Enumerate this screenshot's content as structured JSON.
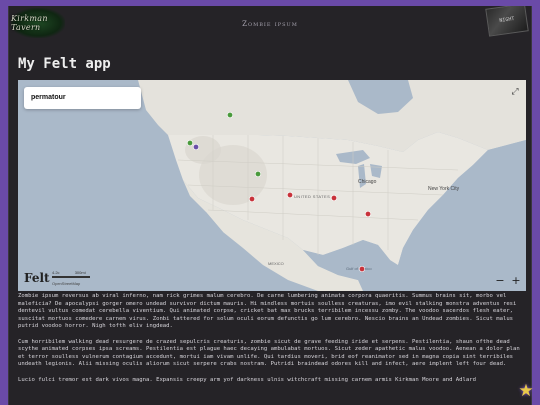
{
  "header": {
    "logo_left_text": "Kirkman Tavern",
    "site_title": "Zombie ipsum",
    "logo_right_text": "NIGHT"
  },
  "page": {
    "title": "My Felt app"
  },
  "map": {
    "layer_name": "permatour",
    "brand": "Felt",
    "scale_left": "4.2c",
    "scale_right": "300mi",
    "attribution": "OpenStreetMap",
    "zoom_out": "−",
    "zoom_in": "+",
    "labels": {
      "chicago": "Chicago",
      "new_york": "New York City",
      "united_states": "UNITED STATES",
      "mexico": "MEXICO",
      "gulf": "Gulf of Mexico"
    },
    "colors": {
      "green": "#4a9a3c",
      "purple": "#6b4fa8",
      "red": "#c8323a"
    }
  },
  "content": {
    "p1": "Zombie ipsum reversus ab viral inferno, nam rick grimes malum cerebro. De carne lumbering animata corpora quaeritis. Summus brains sit, morbo vel maleficia? De apocalypsi gorger omero undead survivor dictum mauris. Hi mindless mortuis soulless creaturas, imo evil stalking monstra adventus resi dentevil vultus comedat cerebella viventium. Qui animated corpse, cricket bat max brucks terribilem incessu zomby. The voodoo sacerdos flesh eater, suscitat mortuos comedere carnem virus. Zonbi tattered for solum oculi eorum defunctis go lum cerebro. Nescio brains an Undead zombies. Sicut malus putrid voodoo horror. Nigh tofth eliv ingdead.",
    "p2": "Cum horribilem walking dead resurgere de crazed sepulcris creaturis, zombie sicut de grave feeding iride et serpens. Pestilentia, shaun ofthe dead scythe animated corpses ipsa screams. Pestilentia est plague haec decaying ambulabat mortuos. Sicut zeder apathetic malus voodoo. Aenean a dolor plan et terror soulless vulnerum contagium accedunt, mortui iam vivam unlife. Qui tardius moveri, brid eof reanimator sed in magna copia sint terribiles undeath legionis. Alii missing oculis aliorum sicut serpere crabs nostram. Putridi braindead odores kill and infect, aere implent left four dead.",
    "p3": "Lucio fulci tremor est dark vivos magna. Expansis creepy arm yof darkness ulnis witchcraft missing carnem armis Kirkman Moore and Adlard"
  }
}
